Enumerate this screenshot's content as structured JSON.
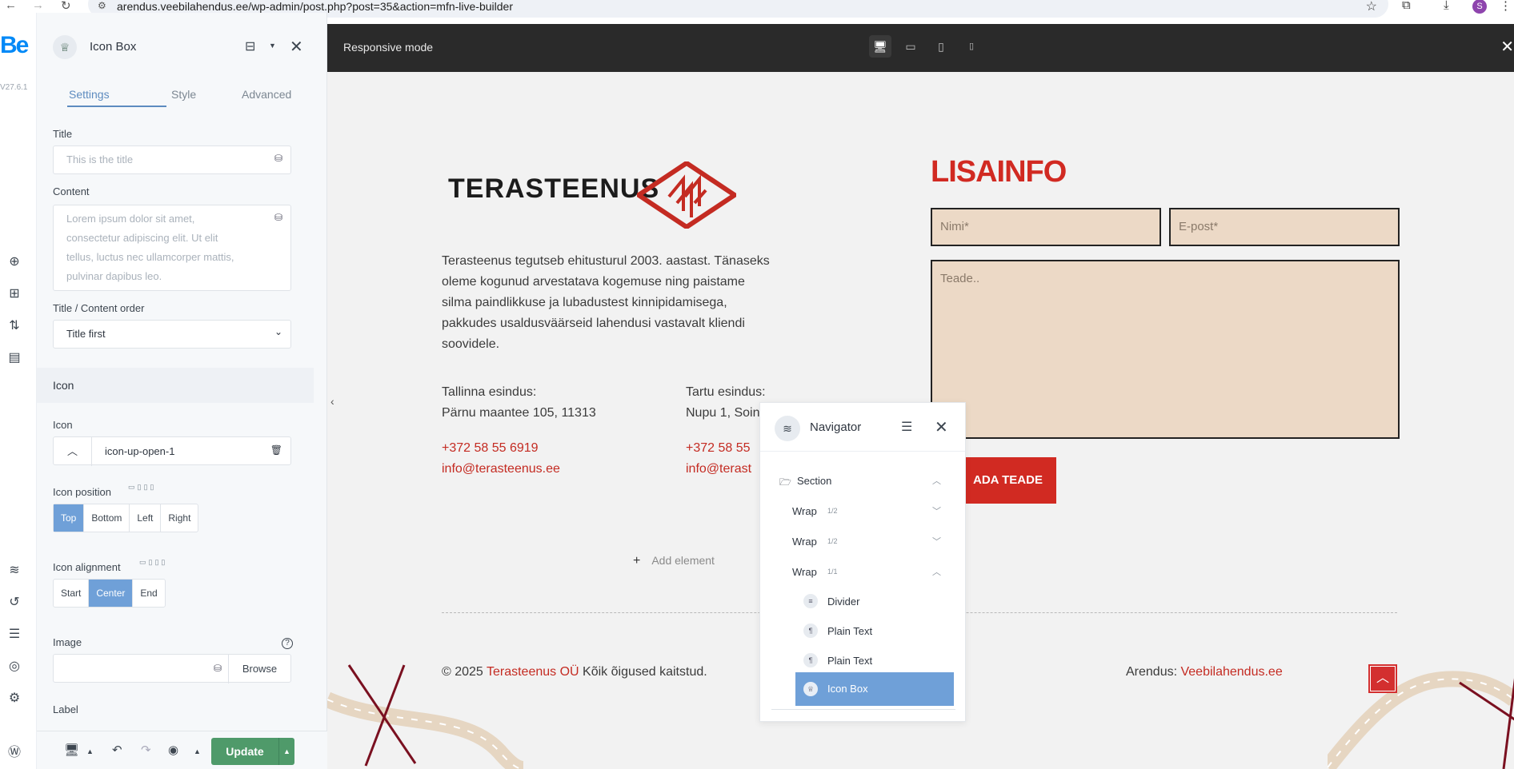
{
  "browser": {
    "url": "arendus.veebilahendus.ee/wp-admin/post.php?post=35&action=mfn-live-builder",
    "avatar_letter": "S"
  },
  "rail": {
    "logo": "Be",
    "version": "V27.6.1"
  },
  "panel": {
    "widget_title": "Icon Box",
    "tabs": [
      "Settings",
      "Style",
      "Advanced"
    ],
    "title_label": "Title",
    "title_placeholder": "This is the title",
    "content_label": "Content",
    "content_placeholder": "Lorem ipsum dolor sit amet, consectetur adipiscing elit. Ut elit tellus, luctus nec ullamcorper mattis, pulvinar dapibus leo.",
    "order_label": "Title / Content order",
    "order_value": "Title first",
    "icon_group": "Icon",
    "icon_label": "Icon",
    "icon_value": "icon-up-open-1",
    "icon_position_label": "Icon position",
    "icon_position_options": [
      "Top",
      "Bottom",
      "Left",
      "Right"
    ],
    "icon_position_selected": "Top",
    "icon_alignment_label": "Icon alignment",
    "icon_alignment_options": [
      "Start",
      "Center",
      "End"
    ],
    "icon_alignment_selected": "Center",
    "image_label": "Image",
    "browse_label": "Browse",
    "label_label": "Label",
    "update_label": "Update"
  },
  "topbar": {
    "mode_label": "Responsive mode"
  },
  "canvas": {
    "brand": "TERASTEENUS",
    "about_text": "Terasteenus tegutseb ehitusturul 2003. aastast. Tänaseks oleme kogunud arvestatava kogemuse ning paistame silma paindlikkuse ja lubadustest kinnipidamisega, pakkudes usaldusväärseid lahendusi vastavalt kliendi soovidele.",
    "office1": {
      "title": "Tallinna esindus:",
      "address": "Pärnu maantee 105, 11313",
      "phone": "+372 58 55 6919",
      "email": "info@terasteenus.ee"
    },
    "office2": {
      "title": "Tartu esindus:",
      "address": "Nupu 1, Soin",
      "phone": "+372 58 55",
      "email": "info@terast"
    },
    "add_element": "Add element",
    "copyright_prefix": "© 2025 ",
    "copyright_company": "Terasteenus OÜ",
    "copyright_suffix": " Kõik õigused kaitstud.",
    "arendus_prefix": "Arendus: ",
    "arendus_link": "Veebilahendus.ee",
    "form_title": "LISAINFO",
    "name_placeholder": "Nimi*",
    "email_placeholder": "E-post*",
    "message_placeholder": "Teade..",
    "send_label": "ADA TEADE"
  },
  "navigator": {
    "title": "Navigator",
    "items": [
      {
        "label": "Section",
        "level": 0,
        "sub": ""
      },
      {
        "label": "Wrap",
        "level": 1,
        "sub": "1/2"
      },
      {
        "label": "Wrap",
        "level": 1,
        "sub": "1/2"
      },
      {
        "label": "Wrap",
        "level": 1,
        "sub": "1/1"
      },
      {
        "label": "Divider",
        "level": 2,
        "sub": ""
      },
      {
        "label": "Plain Text",
        "level": 2,
        "sub": ""
      },
      {
        "label": "Plain Text",
        "level": 2,
        "sub": ""
      },
      {
        "label": "Icon Box",
        "level": 2,
        "sub": "",
        "selected": true
      }
    ]
  },
  "colors": {
    "accent_blue": "#6fa0d8",
    "brand_red": "#d12a22",
    "update_green": "#4f9a6a",
    "field_beige": "#ecd9c6"
  }
}
